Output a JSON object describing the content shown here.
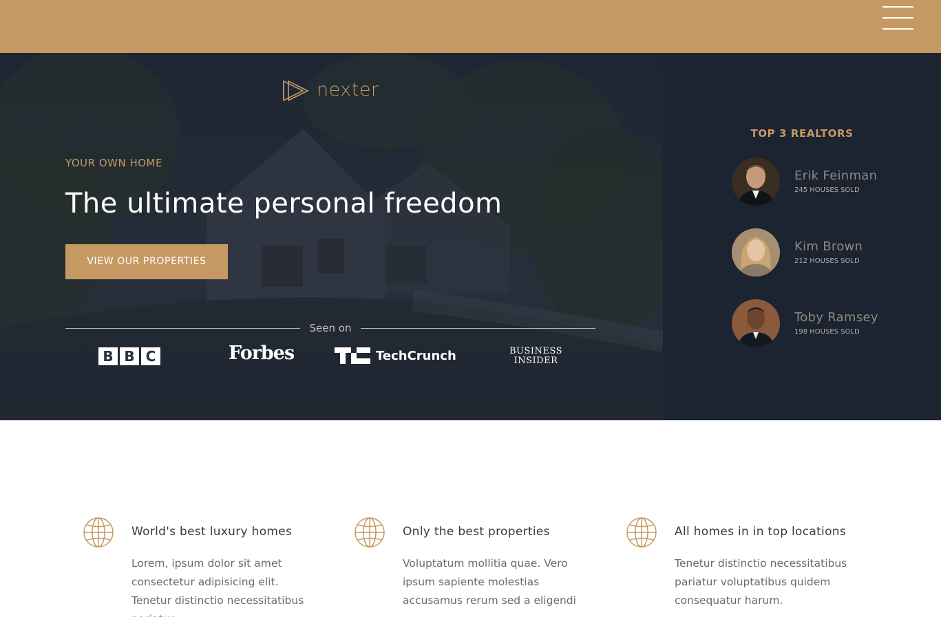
{
  "topbar": {
    "menu_icon": "hamburger-menu-icon",
    "color": "#c69963"
  },
  "hero": {
    "logo_text": "nexter",
    "eyebrow": "YOUR OWN HOME",
    "headline": "The ultimate personal freedom",
    "cta_label": "VIEW OUR PROPERTIES",
    "seen_on": "Seen on",
    "brands": {
      "bbc": [
        "B",
        "B",
        "C"
      ],
      "forbes": "Forbes",
      "techcrunch": "TechCrunch",
      "business_insider_line1": "BUSINESS",
      "business_insider_line2": "INSIDER"
    }
  },
  "sidebar": {
    "title": "TOP 3 REALTORS",
    "realtors": [
      {
        "name": "Erik Feinman",
        "sold": "245 HOUSES SOLD"
      },
      {
        "name": "Kim Brown",
        "sold": "212 HOUSES SOLD"
      },
      {
        "name": "Toby Ramsey",
        "sold": "198 HOUSES SOLD"
      }
    ]
  },
  "features": [
    {
      "icon": "globe-icon",
      "title": "World's best luxury homes",
      "text": "Lorem, ipsum dolor sit amet consectetur adipisicing elit. Tenetur distinctio necessitatibus pariatur"
    },
    {
      "icon": "globe-icon",
      "title": "Only the best properties",
      "text": "Voluptatum mollitia quae. Vero ipsum sapiente molestias accusamus rerum sed a eligendi"
    },
    {
      "icon": "globe-icon",
      "title": "All homes in in top locations",
      "text": "Tenetur distinctio necessitatibus pariatur voluptatibus quidem consequatur harum."
    }
  ],
  "colors": {
    "gold": "#c69963",
    "navy": "#1c2331",
    "hero_dark": "#232b37"
  }
}
